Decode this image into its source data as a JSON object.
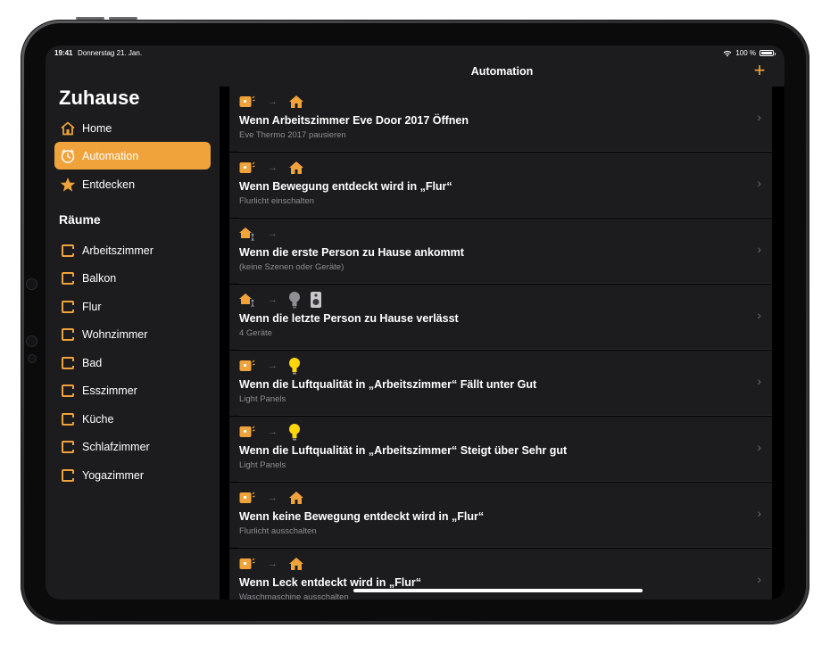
{
  "status_bar": {
    "time": "19:41",
    "date": "Donnerstag 21. Jan.",
    "battery": "100 %"
  },
  "sidebar": {
    "title": "Zuhause",
    "nav": [
      {
        "label": "Home",
        "icon": "house-icon",
        "active": false
      },
      {
        "label": "Automation",
        "icon": "clock-icon",
        "active": true
      },
      {
        "label": "Entdecken",
        "icon": "star-icon",
        "active": false
      }
    ],
    "rooms_heading": "Räume",
    "rooms": [
      "Arbeitszimmer",
      "Balkon",
      "Flur",
      "Wohnzimmer",
      "Bad",
      "Esszimmer",
      "Küche",
      "Schlafzimmer",
      "Yogazimmer"
    ]
  },
  "header": {
    "title": "Automation",
    "add_label": "+"
  },
  "automations": [
    {
      "title": "Wenn Arbeitszimmer Eve Door 2017 Öffnen",
      "subtitle": "Eve Thermo 2017 pausieren"
    },
    {
      "title": "Wenn Bewegung entdeckt wird in „Flur“",
      "subtitle": "Flurlicht einschalten"
    },
    {
      "title": "Wenn die erste Person zu Hause ankommt",
      "subtitle": "(keine Szenen oder Geräte)"
    },
    {
      "title": "Wenn die letzte Person zu Hause verlässt",
      "subtitle": "4 Geräte"
    },
    {
      "title": "Wenn die Luftqualität in „Arbeitszimmer“ Fällt unter Gut",
      "subtitle": "Light Panels"
    },
    {
      "title": "Wenn die Luftqualität in „Arbeitszimmer“ Steigt über Sehr gut",
      "subtitle": "Light Panels"
    },
    {
      "title": "Wenn keine Bewegung entdeckt wird in „Flur“",
      "subtitle": "Flurlicht ausschalten"
    },
    {
      "title": "Wenn Leck entdeckt wird in „Flur“",
      "subtitle": "Waschmaschine ausschalten"
    }
  ],
  "colors": {
    "accent": "#f0a33b",
    "background": "#000000",
    "panel": "#1c1c1e",
    "secondary_text": "#8e8e93"
  }
}
